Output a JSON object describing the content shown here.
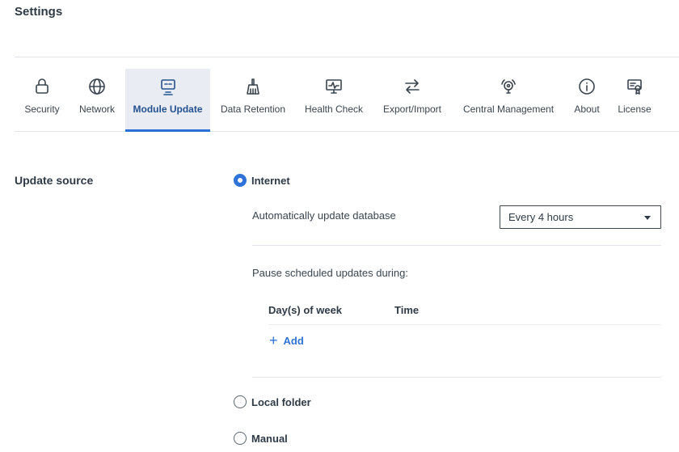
{
  "page": {
    "title": "Settings"
  },
  "tabs": [
    {
      "label": "Security",
      "icon": "lock-icon"
    },
    {
      "label": "Network",
      "icon": "globe-icon"
    },
    {
      "label": "Module Update",
      "icon": "update-module-icon",
      "active": true
    },
    {
      "label": "Data Retention",
      "icon": "broom-icon"
    },
    {
      "label": "Health Check",
      "icon": "monitor-pulse-icon"
    },
    {
      "label": "Export/Import",
      "icon": "arrows-exchange-icon"
    },
    {
      "label": "Central Management",
      "icon": "central-management-icon"
    },
    {
      "label": "About",
      "icon": "info-icon"
    },
    {
      "label": "License",
      "icon": "certificate-icon"
    }
  ],
  "update_source": {
    "label": "Update source",
    "options": {
      "internet": {
        "label": "Internet",
        "checked": true
      },
      "local_folder": {
        "label": "Local folder",
        "checked": false
      },
      "manual": {
        "label": "Manual",
        "checked": false
      }
    },
    "auto_update": {
      "label": "Automatically update database",
      "selected": "Every 4 hours"
    },
    "pause": {
      "label": "Pause scheduled updates during:",
      "columns": {
        "days": "Day(s) of week",
        "time": "Time"
      },
      "add_label": "Add"
    }
  },
  "colors": {
    "accent": "#2f72d8",
    "active_tab_bg": "#e9ecf3",
    "text": "#2e3a46"
  }
}
